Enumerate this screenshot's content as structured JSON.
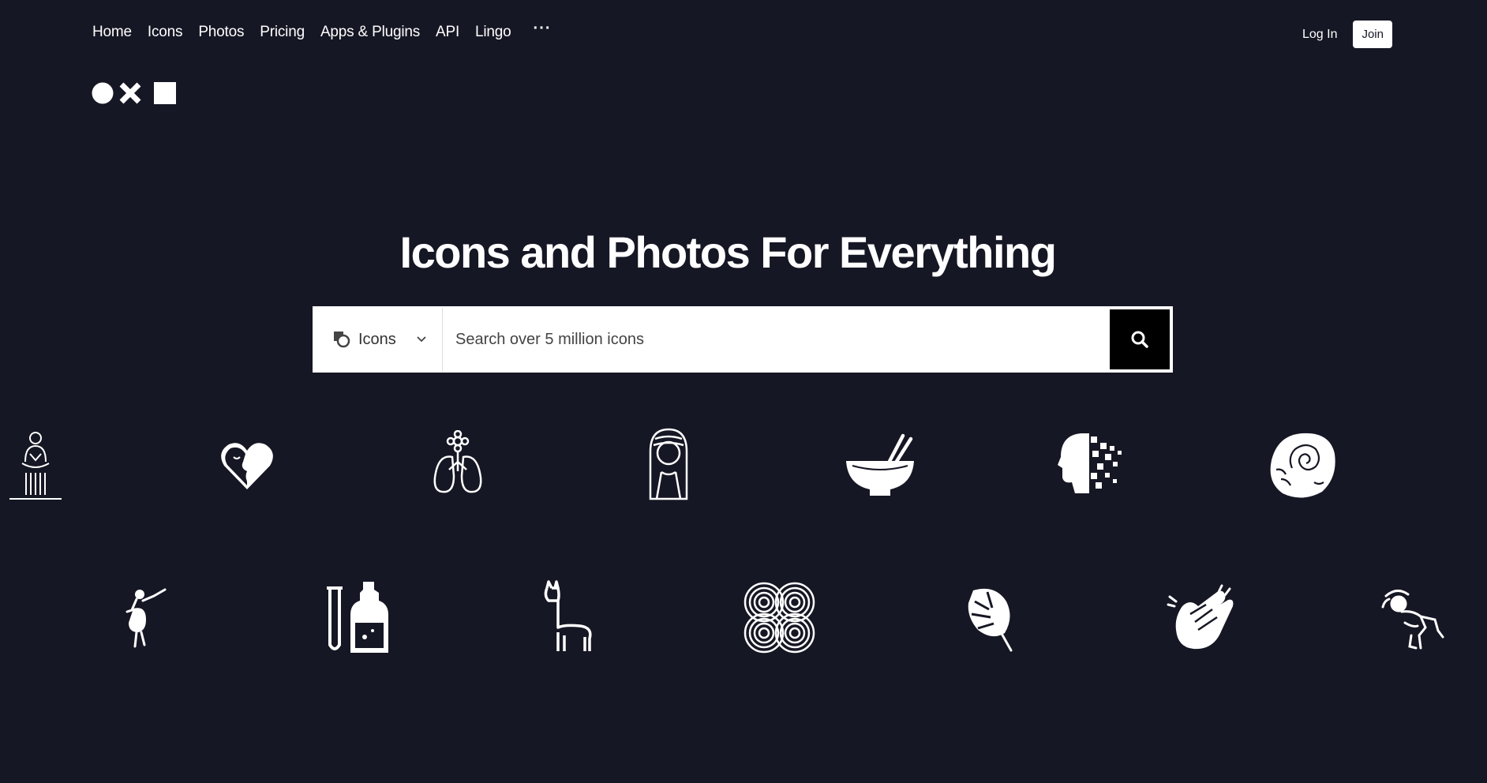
{
  "nav": {
    "items": [
      {
        "label": "Home"
      },
      {
        "label": "Icons"
      },
      {
        "label": "Photos"
      },
      {
        "label": "Pricing"
      },
      {
        "label": "Apps & Plugins"
      },
      {
        "label": "API"
      },
      {
        "label": "Lingo"
      }
    ],
    "more_label": "···"
  },
  "auth": {
    "login_label": "Log In",
    "join_label": "Join"
  },
  "hero": {
    "title": "Icons and Photos For Everything"
  },
  "search": {
    "type_label": "Icons",
    "placeholder": "Search over 5 million icons"
  },
  "colors": {
    "background": "#161724",
    "foreground": "#ffffff",
    "search_button": "#000000"
  },
  "featured_icons": [
    "meditation-shower-icon",
    "heart-face-icon",
    "lungs-flower-icon",
    "woman-portrait-icon",
    "bowl-chopsticks-icon",
    "pixel-head-icon",
    "fossil-stone-icon",
    "dancer-icon",
    "test-tube-bottle-icon",
    "llama-icon",
    "concentric-circles-icon",
    "monstera-leaf-icon",
    "clapping-hands-icon",
    "dizzy-person-icon"
  ]
}
